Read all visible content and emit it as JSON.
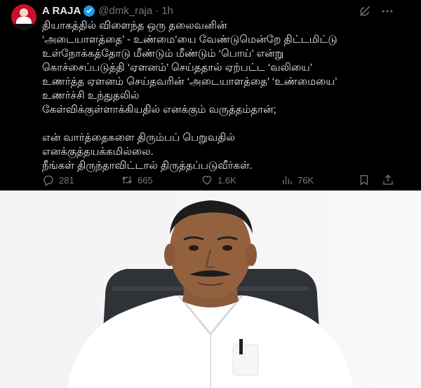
{
  "post": {
    "author_name": "A RAJA",
    "handle": "@dmk_raja",
    "separator": "·",
    "time": "1h",
    "lines": [
      "தியாகத்தில் விளைந்த ஒரு தலைவனின்",
      "‘அடையாளத்தை’ - உண்மை’யை வேண்டுமென்றே திட்டமிட்டு",
      "உள்நோக்கத்தோடு மீண்டும் மீண்டும் ‘பொய்’ என்று",
      "கொச்சைப்படுத்தி ‘ஏளனம்’ செய்ததால் ஏற்பட்ட ‘வலியை’",
      "உணர்த்த ஏளனம் செய்தவரின் ‘அடையாளத்தை’ ‘உண்மையை’",
      "உணர்ச்சி உந்துதலில்",
      "கேள்விக்குள்ளாக்கியதில் எனக்கும் வருத்தம்தான்;",
      "",
      "என் வார்த்தைகளை திரும்பப் பெறுவதில்",
      "எனக்குத்தயக்கமில்லை.",
      "நீங்கள் திருந்தாவிட்டால் திருத்தப்படுவீர்கள்."
    ],
    "stats": {
      "replies": "281",
      "reposts": "665",
      "likes": "1.6K",
      "views": "76K"
    }
  },
  "icons": {
    "verified": "verified-badge-icon",
    "grok": "grok-icon",
    "more": "more-options-icon",
    "reply": "reply-icon",
    "repost": "repost-icon",
    "like": "heart-icon",
    "views": "views-chart-icon",
    "bookmark": "bookmark-icon",
    "share": "share-icon"
  },
  "colors": {
    "tweet_background": "#000000",
    "text": "#e7e9ea",
    "muted": "#71767b",
    "verified_blue": "#1d9bf0"
  }
}
